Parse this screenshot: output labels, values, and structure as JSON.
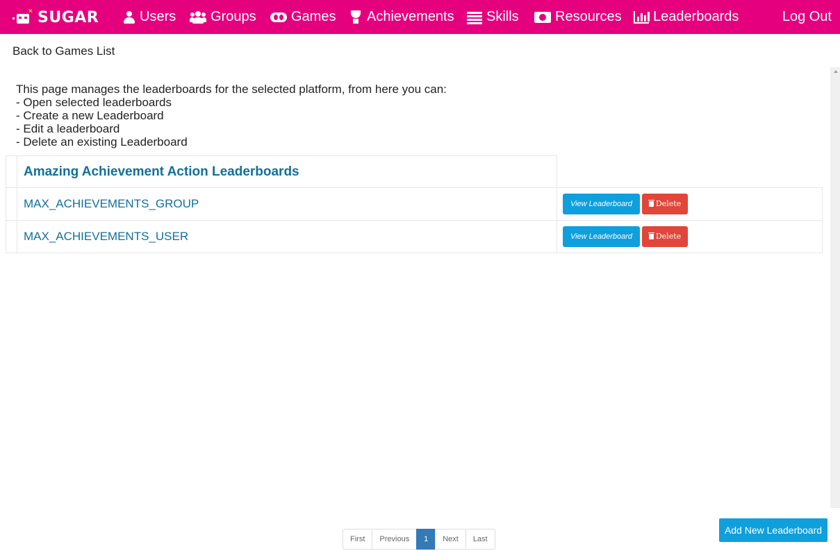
{
  "nav": {
    "brand": "SUGAR",
    "items": [
      {
        "label": "Users",
        "icon": "user-icon"
      },
      {
        "label": "Groups",
        "icon": "group-icon"
      },
      {
        "label": "Games",
        "icon": "gamepad-icon"
      },
      {
        "label": "Achievements",
        "icon": "trophy-icon"
      },
      {
        "label": "Skills",
        "icon": "skills-icon"
      },
      {
        "label": "Resources",
        "icon": "money-icon"
      },
      {
        "label": "Leaderboards",
        "icon": "bar-chart-icon"
      }
    ],
    "logout": "Log Out",
    "color": "#e5007e"
  },
  "back_link": "Back to Games List",
  "intro": {
    "heading": "This page manages the leaderboards for the selected platform, from here you can:",
    "lines": [
      "- Open selected leaderboards",
      "- Create a new Leaderboard",
      "- Edit a leaderboard",
      "- Delete an existing Leaderboard"
    ]
  },
  "table": {
    "title": "Amazing Achievement Action Leaderboards",
    "rows": [
      {
        "name": "MAX_ACHIEVEMENTS_GROUP",
        "view_label": "View Leaderboard",
        "delete_label": "Delete"
      },
      {
        "name": "MAX_ACHIEVEMENTS_USER",
        "view_label": "View Leaderboard",
        "delete_label": "Delete"
      }
    ]
  },
  "pagination": {
    "first": "First",
    "previous": "Previous",
    "current": "1",
    "next": "Next",
    "last": "Last"
  },
  "add_button": "Add New Leaderboard"
}
